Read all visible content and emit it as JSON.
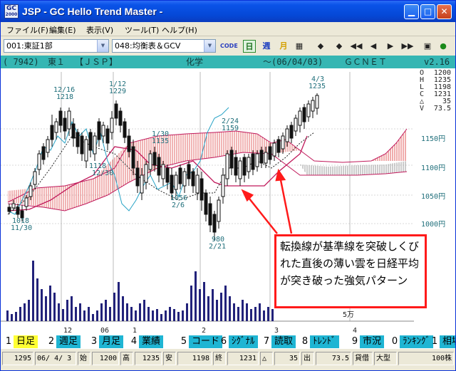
{
  "window": {
    "title": "JSP - GC Hello Trend Master -",
    "icon_top": "GC",
    "icon_bottom": "2000",
    "controls": [
      "minimize-icon",
      "maximize-icon",
      "close-icon"
    ]
  },
  "menu": [
    {
      "label": "ファイル(F)"
    },
    {
      "label": "編集(E)"
    },
    {
      "label": "表示(V)"
    },
    {
      "label": "ツール(T)"
    },
    {
      "label": "ヘルプ(H)"
    }
  ],
  "toolbar": {
    "market_select": "001:東証1部",
    "indicator_select": "048:均衡表＆GCV",
    "code_button": "CODE",
    "day_button": "日",
    "week_button": "週",
    "month_button": "月"
  },
  "info_band": {
    "code": "( 7942)",
    "market": "東１",
    "name": "【ＪＳＰ】",
    "sector": "化学",
    "date": "～(06/04/03)",
    "source": "ＧＣＮＥＴ",
    "version": "v2.16"
  },
  "stats": [
    {
      "k": "O",
      "v": "1200"
    },
    {
      "k": "H",
      "v": "1235"
    },
    {
      "k": "L",
      "v": "1198"
    },
    {
      "k": "C",
      "v": "1231"
    },
    {
      "k": "△",
      "v": "35"
    },
    {
      "k": "V",
      "v": "73.5"
    }
  ],
  "chart_data": {
    "type": "line",
    "title": "",
    "y_ticks": [
      "1150円",
      "1100円",
      "1050円",
      "1000円"
    ],
    "volume_unit": "5万",
    "x_month_labels": [
      "12",
      "06",
      "1",
      "2",
      "3",
      "4"
    ],
    "annotations": [
      {
        "label": "12/16",
        "value": "1218"
      },
      {
        "label": "1/12",
        "value": "1229"
      },
      {
        "label": "1/30",
        "value": "1135"
      },
      {
        "label": "2/24",
        "value": "1159"
      },
      {
        "label": "4/3",
        "value": "1235"
      },
      {
        "label": "12/30",
        "value": "1118"
      },
      {
        "label": "2/6",
        "value": "1056"
      },
      {
        "label": "11/30",
        "value": "1018"
      },
      {
        "label": "2/21",
        "value": "980"
      }
    ]
  },
  "callout": {
    "text": "転換線が基準線を突破しくびれた直後の薄い雲を日経平均が突き破った強気パターン"
  },
  "tabs": [
    {
      "num": "1",
      "label": "日足",
      "active": true
    },
    {
      "num": "2",
      "label": "週足"
    },
    {
      "num": "3",
      "label": "月足"
    },
    {
      "num": "4",
      "label": "業績"
    },
    {
      "num": "5",
      "label": "コード"
    },
    {
      "num": "6",
      "label": "ｼｸﾞﾅﾙ"
    },
    {
      "num": "7",
      "label": "読取"
    },
    {
      "num": "8",
      "label": "ﾄﾚﾝﾄﾞ"
    },
    {
      "num": "9",
      "label": "市況"
    },
    {
      "num": "0",
      "label": "ﾗﾝｷﾝｸﾞ"
    },
    {
      "num": "1",
      "label": "相場"
    }
  ],
  "status": [
    "1295",
    "06/ 4/ 3",
    "始",
    "1200",
    "高",
    "1235",
    "安",
    "1198",
    "終",
    "1231",
    "△",
    "35",
    "出",
    "73.5",
    "貸借",
    "大型",
    "100株"
  ]
}
